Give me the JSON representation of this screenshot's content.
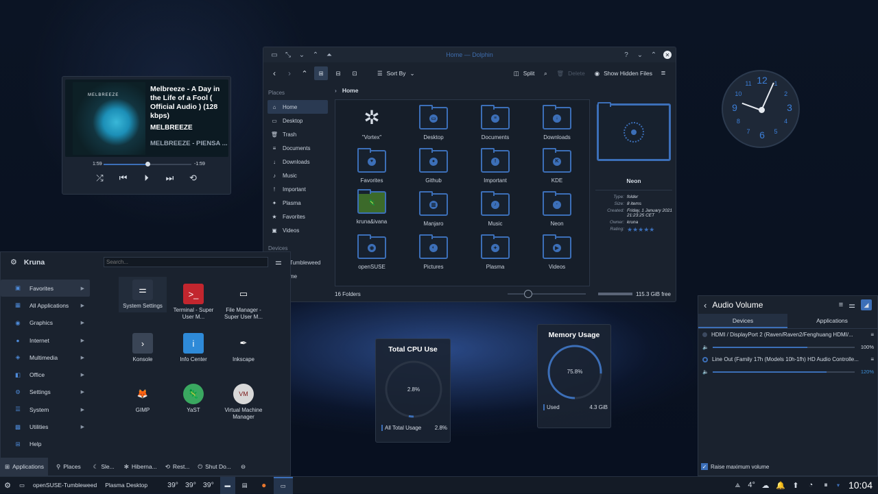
{
  "media": {
    "title": "Melbreeze - A Day in the Life of a Fool ( Official Audio ) (128 kbps)",
    "artist": "MELBREEZE",
    "album": "MELBREEZE - PIENSA ...",
    "time_elapsed": "1:59",
    "time_remaining": "-1:59",
    "progress": 0.5,
    "cover_text": "MELBREEZE"
  },
  "dolphin": {
    "title": "Home — Dolphin",
    "sort_label": "Sort By",
    "split_label": "Split",
    "delete_label": "Delete",
    "hidden_label": "Show Hidden Files",
    "breadcrumb": "Home",
    "places_header": "Places",
    "devices_header": "Devices",
    "places": [
      "Home",
      "Desktop",
      "Trash",
      "Documents",
      "Downloads",
      "Music",
      "Important",
      "Plasma",
      "Favorites",
      "Videos"
    ],
    "devices": [
      "Tumbleweed",
      "me"
    ],
    "files": [
      {
        "name": "\"Vortex\"",
        "sym": "✲"
      },
      {
        "name": "Desktop",
        "sym": "▭"
      },
      {
        "name": "Documents",
        "sym": "≡"
      },
      {
        "name": "Downloads",
        "sym": "↓"
      },
      {
        "name": "Favorites",
        "sym": "♥"
      },
      {
        "name": "Github",
        "sym": "●"
      },
      {
        "name": "Important",
        "sym": "!"
      },
      {
        "name": "KDE",
        "sym": "K"
      },
      {
        "name": "kruna&ivana",
        "sym": "🦎"
      },
      {
        "name": "Manjaro",
        "sym": "▥"
      },
      {
        "name": "Music",
        "sym": "♪"
      },
      {
        "name": "Neon",
        "sym": "·"
      },
      {
        "name": "openSUSE",
        "sym": "◉"
      },
      {
        "name": "Pictures",
        "sym": "◐"
      },
      {
        "name": "Plasma",
        "sym": "✦"
      },
      {
        "name": "Videos",
        "sym": "▶"
      }
    ],
    "info": {
      "name": "Neon",
      "type_k": "Type:",
      "type_v": "folder",
      "size_k": "Size:",
      "size_v": "8 items",
      "created_k": "Created:",
      "created_v": "Friday, 1 January 2021 21:23:25 CET",
      "owner_k": "Owner:",
      "owner_v": "kruna",
      "rating_k": "Rating:",
      "rating_v": "★★★★★"
    },
    "status": "16 Folders",
    "free": "115.3 GiB free"
  },
  "menu": {
    "user": "Kruna",
    "search_placeholder": "Search...",
    "categories": [
      "Favorites",
      "All Applications",
      "Graphics",
      "Internet",
      "Multimedia",
      "Office",
      "Settings",
      "System",
      "Utilities",
      "Help"
    ],
    "apps": [
      "System Settings",
      "Terminal - Super User M...",
      "File Manager - Super User M...",
      "Konsole",
      "Info Center",
      "Inkscape",
      "GIMP",
      "YaST",
      "Virtual Machine Manager"
    ],
    "tabs": [
      "Applications",
      "Places"
    ],
    "power": [
      "Sle...",
      "Hiberna...",
      "Rest...",
      "Shut Do..."
    ]
  },
  "cpu": {
    "title": "Total CPU Use",
    "value": "2.8%",
    "legend": "All Total Usage",
    "legend_val": "2.8%",
    "fraction": 0.028
  },
  "mem": {
    "title": "Memory Usage",
    "value": "75.8%",
    "legend": "Used",
    "legend_val": "4.3 GiB",
    "fraction": 0.758
  },
  "audio": {
    "title": "Audio Volume",
    "tab_devices": "Devices",
    "tab_apps": "Applications",
    "dev1": "HDMI / DisplayPort 2 (Raven/Raven2/Fenghuang HDMI/...",
    "dev1_vol": "100%",
    "dev1_level": 1.0,
    "dev2": "Line Out (Family 17h (Models 10h-1fh) HD Audio Controlle...",
    "dev2_vol": "120%",
    "dev2_level": 1.2,
    "raise": "Raise maximum volume"
  },
  "clock": {
    "time": "10:04",
    "numbers": [
      "12",
      "1",
      "2",
      "3",
      "4",
      "5",
      "6",
      "7",
      "8",
      "9",
      "10",
      "11"
    ]
  },
  "taskbar": {
    "task1": "openSUSE-Tumbleweed",
    "task2": "Plasma Desktop",
    "temps": [
      "39°",
      "39°",
      "39°"
    ],
    "weather": "4°",
    "clock": "10:04"
  },
  "colors": {
    "accent": "#3c6fb8",
    "bg": "#1a222e"
  }
}
